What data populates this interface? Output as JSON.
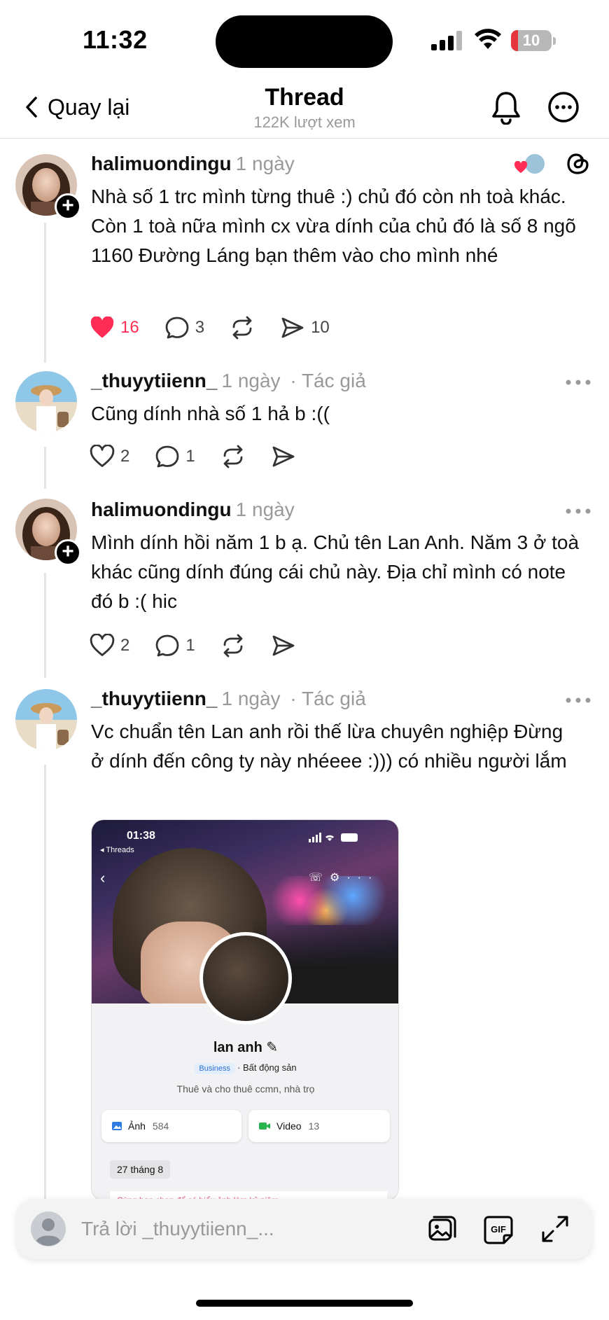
{
  "status_bar": {
    "time": "11:32",
    "battery": "10"
  },
  "nav": {
    "back_label": "Quay lại",
    "title": "Thread",
    "subtitle": "122K lượt xem"
  },
  "posts": [
    {
      "username": "halimuondingu",
      "time": "1 ngày",
      "author_tag": "",
      "text": "Nhà số 1 trc mình từng thuê :) chủ đó còn nh toà khác. Còn 1 toà nữa mình cx vừa dính của chủ đó là số 8 ngõ 1160 Đường Láng bạn thêm vào cho mình nhé",
      "likes": "16",
      "liked": true,
      "replies": "3",
      "reposts": "",
      "shares": "10"
    },
    {
      "username": "_thuyytiienn_",
      "time": "1 ngày",
      "author_tag": "· Tác giả",
      "text": "Cũng dính nhà số 1 hả b :((",
      "likes": "2",
      "liked": false,
      "replies": "1",
      "reposts": "",
      "shares": ""
    },
    {
      "username": "halimuondingu",
      "time": "1 ngày",
      "author_tag": "",
      "text": "Mình dính hồi năm 1 b ạ. Chủ tên Lan Anh. Năm 3 ở toà khác cũng dính đúng cái chủ này. Địa chỉ mình có note đó b :( hic",
      "likes": "2",
      "liked": false,
      "replies": "1",
      "reposts": "",
      "shares": ""
    },
    {
      "username": "_thuyytiienn_",
      "time": "1 ngày",
      "author_tag": "· Tác giả",
      "text": "Vc chuẩn tên Lan anh rồi thế lừa chuyên nghiệp Đừng ở dính đến công ty này nhéeee :))) có nhiều người lắm"
    }
  ],
  "embedded_screenshot": {
    "time": "01:38",
    "app_back": "◂ Threads",
    "profile_name": "lan anh",
    "badge": "Business",
    "category": "· Bất động sản",
    "bio": "Thuê và cho thuê ccmn, nhà trọ",
    "photos_label": "Ảnh",
    "photos_count": "584",
    "videos_label": "Video",
    "videos_count": "13",
    "date_chip": "27 tháng 8",
    "pink_text": "Cùng bạn chọn để có biểu ảnh làm kỷ niệm"
  },
  "composer": {
    "placeholder": "Trả lời _thuyytiienn_..."
  },
  "colors": {
    "like_red": "#ff2d55",
    "muted": "#999999",
    "divider": "#e3e3e3"
  }
}
